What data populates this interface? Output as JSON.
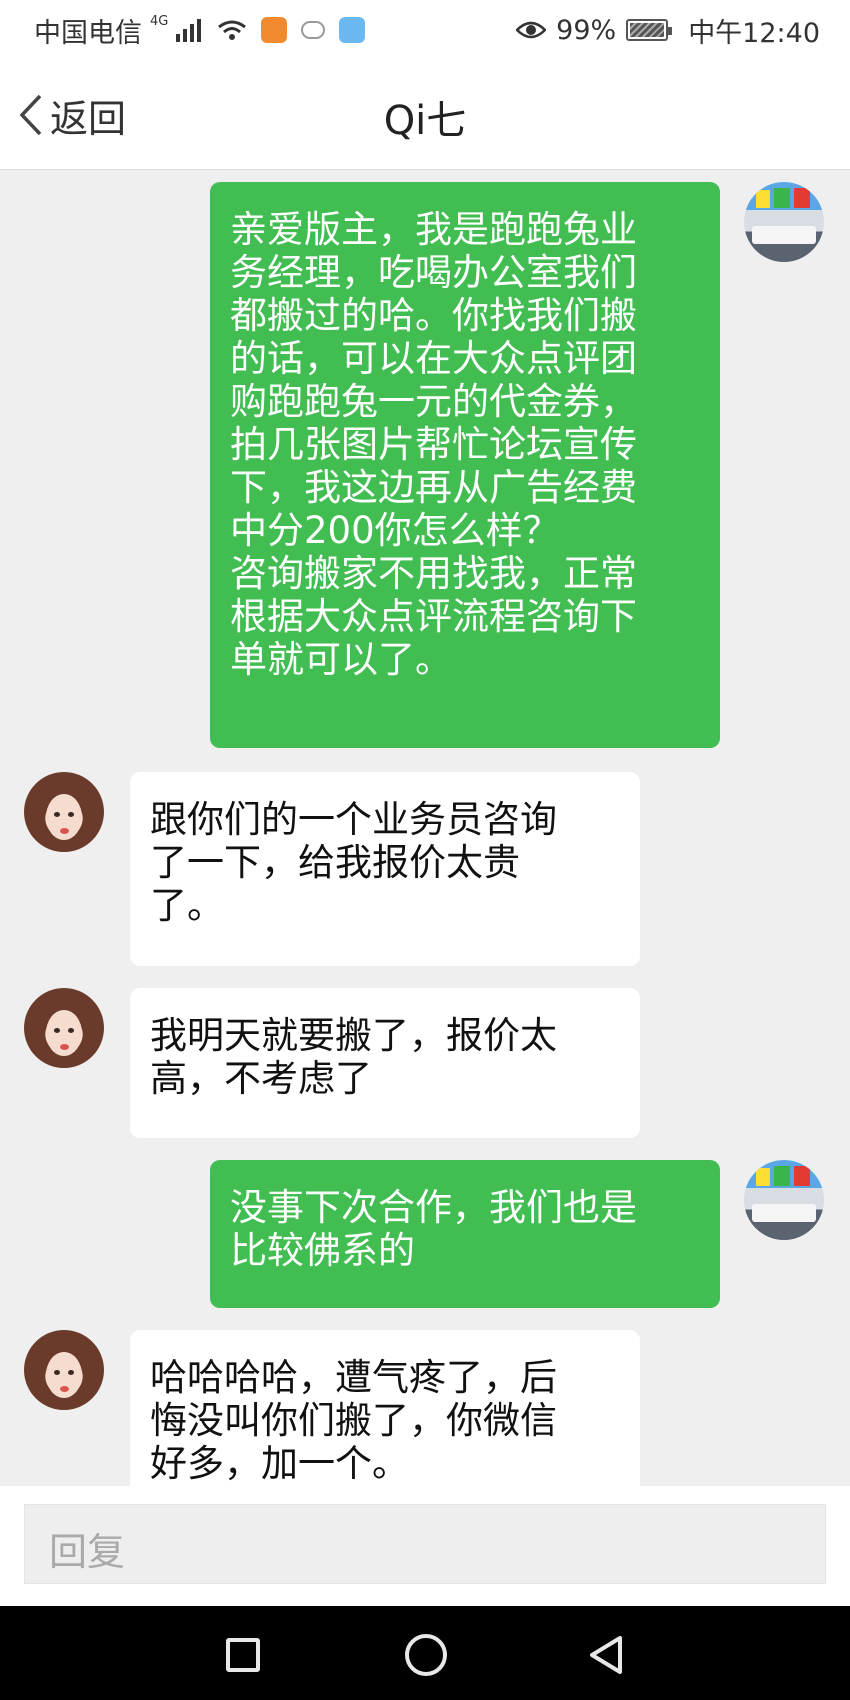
{
  "status_bar": {
    "carrier": "中国电信",
    "network": "4G",
    "battery_percent": "99%",
    "time": "中午12:40"
  },
  "header": {
    "back_label": "返回",
    "title": "Qi七"
  },
  "messages": [
    {
      "side": "out",
      "sender": "self",
      "text": "亲爱版主，我是跑跑兔业\n务经理，吃喝办公室我们\n都搬过的哈。你找我们搬\n的话，可以在大众点评团\n购跑跑兔一元的代金券，\n拍几张图片帮忙论坛宣传\n下，我这边再从广告经费\n中分200你怎么样？\n咨询搬家不用找我，正常\n根据大众点评流程咨询下\n单就可以了。"
    },
    {
      "side": "in",
      "sender": "Qi七",
      "text": "跟你们的一个业务员咨询\n了一下，给我报价太贵\n了。"
    },
    {
      "side": "in",
      "sender": "Qi七",
      "text": "我明天就要搬了，报价太\n高，不考虑了"
    },
    {
      "side": "out",
      "sender": "self",
      "text": "没事下次合作，我们也是\n比较佛系的"
    },
    {
      "side": "in",
      "sender": "Qi七",
      "text": "哈哈哈哈，遭气疼了，后\n悔没叫你们搬了，你微信\n好多，加一个。"
    }
  ],
  "reply": {
    "placeholder": "回复"
  },
  "colors": {
    "bubble_out": "#41bd52",
    "bubble_in": "#ffffff",
    "background": "#efefef"
  },
  "icons": {
    "status": [
      "signal-icon",
      "wifi-icon",
      "app-notification-icon",
      "eye-icon",
      "battery-icon"
    ],
    "nav": [
      "recent-apps-icon",
      "home-icon",
      "back-icon"
    ]
  }
}
